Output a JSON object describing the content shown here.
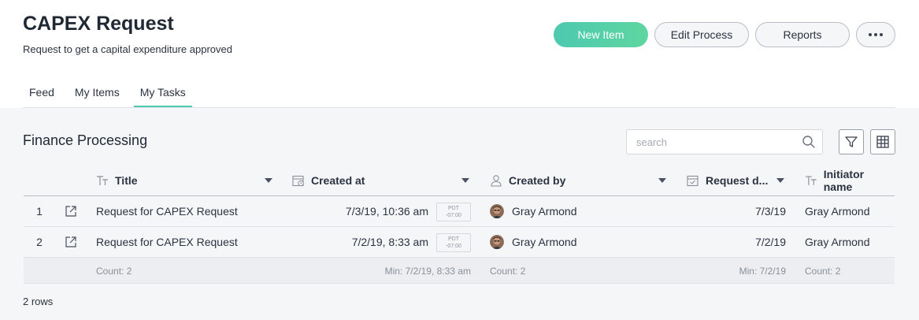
{
  "header": {
    "title": "CAPEX Request",
    "subtitle": "Request to get a capital expenditure approved",
    "buttons": {
      "new_item": "New Item",
      "edit_process": "Edit Process",
      "reports": "Reports"
    }
  },
  "tabs": [
    {
      "label": "Feed",
      "active": false
    },
    {
      "label": "My Items",
      "active": false
    },
    {
      "label": "My Tasks",
      "active": true
    }
  ],
  "section": {
    "title": "Finance Processing",
    "search_placeholder": "search"
  },
  "table": {
    "columns": [
      "Title",
      "Created at",
      "Created by",
      "Request d...",
      "Initiator name"
    ],
    "rows": [
      {
        "num": "1",
        "title": "Request for CAPEX Request",
        "created_at": "7/3/19, 10:36 am",
        "tz_name": "PDT",
        "tz_offset": "-07:00",
        "created_by": "Gray Armond",
        "request_date": "7/3/19",
        "initiator": "Gray Armond"
      },
      {
        "num": "2",
        "title": "Request for CAPEX Request",
        "created_at": "7/2/19, 8:33 am",
        "tz_name": "PDT",
        "tz_offset": "-07:00",
        "created_by": "Gray Armond",
        "request_date": "7/2/19",
        "initiator": "Gray Armond"
      }
    ],
    "footer": {
      "title": "Count: 2",
      "created_at": "Min: 7/2/19, 8:33 am",
      "created_by": "Count: 2",
      "request_date": "Min: 7/2/19",
      "initiator": "Count: 2"
    },
    "row_count": "2 rows"
  },
  "colors": {
    "accent": "#4dc9b0",
    "background": "#f5f6f8"
  },
  "icons": [
    "more-icon",
    "search-icon",
    "filter-icon",
    "grid-icon",
    "text-type-icon",
    "calendar-clock-icon",
    "person-icon",
    "calendar-check-icon",
    "external-link-icon"
  ]
}
